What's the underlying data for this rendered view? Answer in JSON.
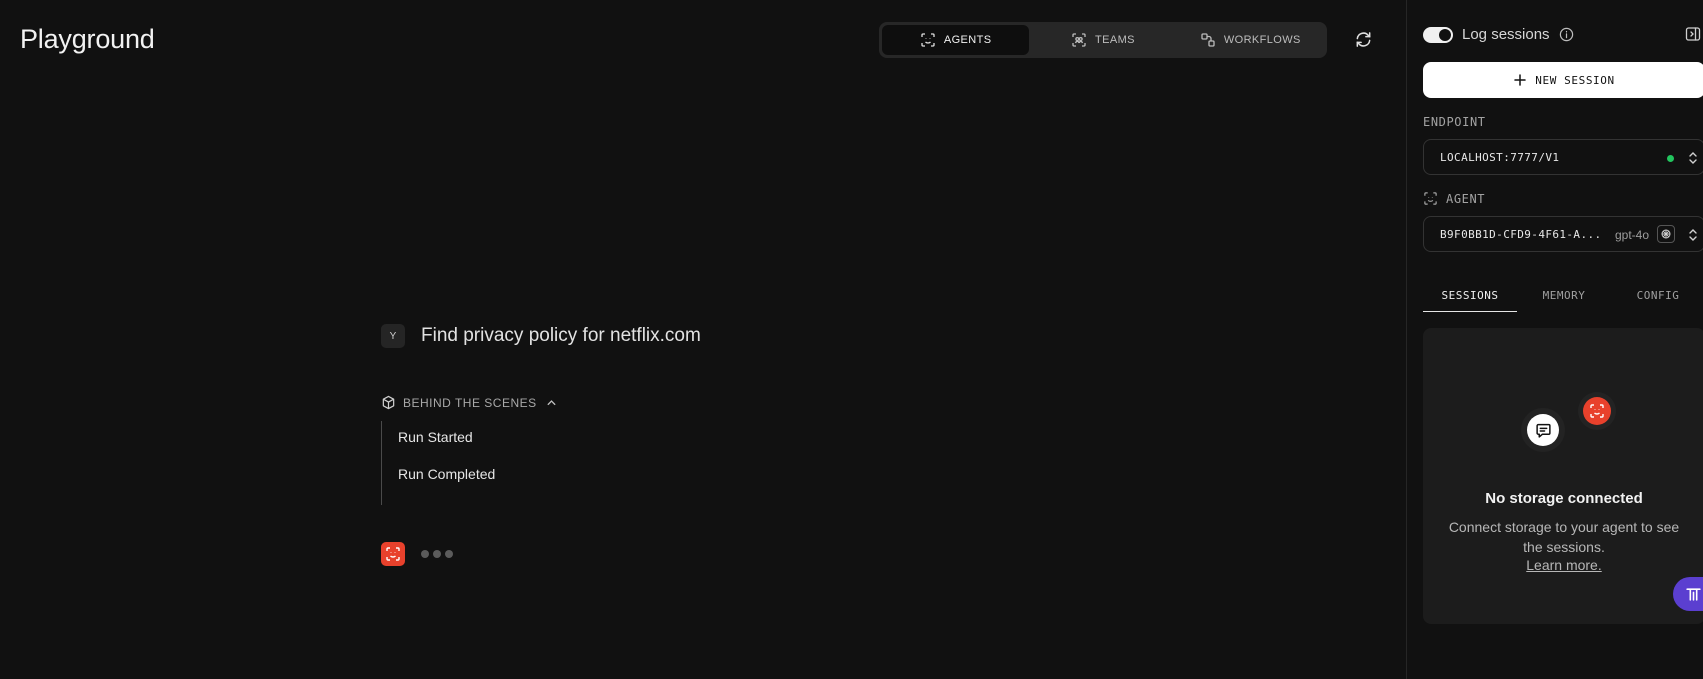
{
  "header": {
    "title": "Playground",
    "tabs": [
      {
        "label": "AGENTS",
        "icon": "agent-icon",
        "active": true
      },
      {
        "label": "TEAMS",
        "icon": "team-icon",
        "active": false
      },
      {
        "label": "WORKFLOWS",
        "icon": "workflow-icon",
        "active": false
      }
    ],
    "refresh_icon": "refresh-icon"
  },
  "chat": {
    "user_avatar": "Y",
    "user_message": "Find privacy policy for netflix.com",
    "behind_the_scenes": {
      "label": "BEHIND THE SCENES",
      "expanded": true,
      "items": [
        "Run Started",
        "Run Completed"
      ]
    },
    "agent_status": "typing"
  },
  "sidebar": {
    "log_sessions": {
      "label": "Log sessions",
      "enabled": true
    },
    "new_session_label": "NEW SESSION",
    "endpoint": {
      "label": "ENDPOINT",
      "value": "LOCALHOST:7777/V1",
      "status_color": "#22c55e"
    },
    "agent": {
      "label": "AGENT",
      "value": "B9F0BB1D-CFD9-4F61-A...",
      "model": "gpt-4o"
    },
    "tabs": [
      {
        "label": "SESSIONS",
        "active": true
      },
      {
        "label": "MEMORY",
        "active": false
      },
      {
        "label": "CONFIG",
        "active": false
      }
    ],
    "empty_state": {
      "title": "No storage connected",
      "description": "Connect storage to your agent to see the sessions.",
      "link": "Learn more."
    }
  },
  "colors": {
    "background": "#111111",
    "accent_agent": "#e8412c",
    "status_ok": "#22c55e",
    "badge_purple": "#5b3fd0"
  }
}
